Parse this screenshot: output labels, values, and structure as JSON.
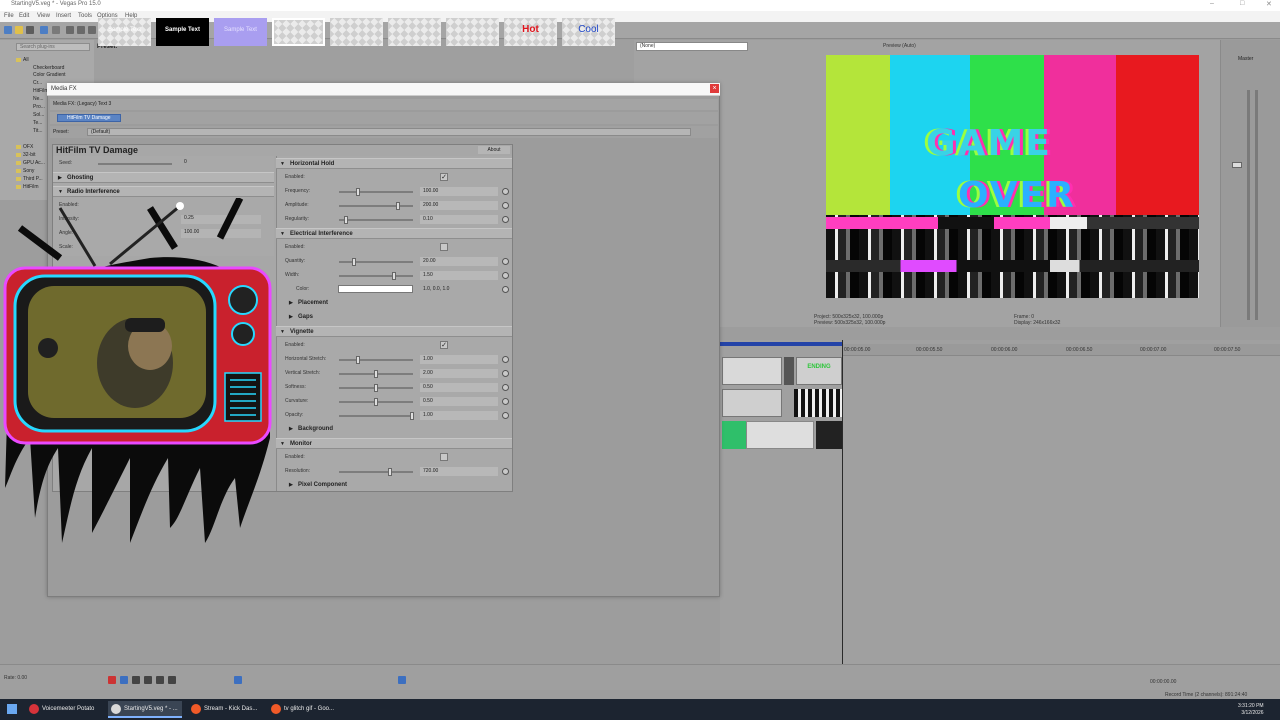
{
  "window": {
    "title": "StartingV5.veg * - Vegas Pro 15.0",
    "menu": [
      "File",
      "Edit",
      "View",
      "Insert",
      "Tools",
      "Options",
      "Help"
    ]
  },
  "explorer": {
    "search_placeholder": "Search plug-ins",
    "items": [
      "All",
      "Checkerboard",
      "Color Gradient",
      "Cr...",
      "HitFilm",
      "Ne...",
      "Pro...",
      "Sol...",
      "Te...",
      "Tit...",
      "OFX",
      "32-bit",
      "GPU Ac...",
      "Sony",
      "Third P...",
      "HitFilm"
    ]
  },
  "presets": {
    "label": "Preset:",
    "items": [
      {
        "text": "Sample Text",
        "style": "checker"
      },
      {
        "text": "Sample Text",
        "style": "black"
      },
      {
        "text": "Sample Text",
        "style": "purple"
      },
      {
        "text": "",
        "style": "checker"
      },
      {
        "text": "",
        "style": "checker"
      },
      {
        "text": "",
        "style": "checker"
      },
      {
        "text": "",
        "style": "checker"
      },
      {
        "text": "Hot",
        "style": "hot"
      },
      {
        "text": "Cool",
        "style": "cool"
      }
    ]
  },
  "preview": {
    "dropdown_value": "(None)",
    "quality_label": "Preview (Auto)",
    "title_line1": "GAME",
    "title_line2": "OVER",
    "project_line": "Project:  500x325x32, 100.000p",
    "preview_line": "Preview:  500x325x32, 100.000p",
    "frame_label": "Frame:",
    "frame_value": "0",
    "display_label": "Display:",
    "display_value": "246x166x32"
  },
  "mixer": {
    "label": "Master"
  },
  "timeline": {
    "ruler": [
      "00:00:05.00",
      "00:00:05.50",
      "00:00:06.00",
      "00:00:06.50",
      "00:00:07.00",
      "00:00:07.50"
    ],
    "clip_label": "ENDING"
  },
  "transport": {
    "rate": "Rate: 0.00",
    "time": "00:00:00.00",
    "record_time": "Record Time (2 channels): 891:24:40"
  },
  "mediafx": {
    "title": "Media FX",
    "header": "Media FX:  (Legacy) Text 3",
    "chain_item": "HitFilm TV Damage",
    "preset_label": "Preset:",
    "preset_value": "(Default)",
    "plugin_title": "HitFilm TV Damage",
    "about": "About",
    "left": {
      "seed_label": "Seed:",
      "seed_value": "0",
      "ghosting": "Ghosting",
      "radio_interference": "Radio Interference",
      "enabled_label": "Enabled:",
      "intensity_label": "Intensity:",
      "intensity_value": "0.25",
      "angle_label": "Angle:",
      "angle_value": "100.00",
      "scale_label": "Scale:"
    },
    "right": {
      "horizontal_hold": "Horizontal Hold",
      "hh_enabled": "Enabled:",
      "frequency_label": "Frequency:",
      "frequency_value": "100.00",
      "amplitude_label": "Amplitude:",
      "amplitude_value": "200.00",
      "regularity_label": "Regularity:",
      "regularity_value": "0.10",
      "electrical_interference": "Electrical Interference",
      "ei_enabled": "Enabled:",
      "quantity_label": "Quantity:",
      "quantity_value": "20.00",
      "width_label": "Width:",
      "width_value": "1.50",
      "color_label": "Color:",
      "color_value": "1.0, 0.0, 1.0",
      "placement": "Placement",
      "gaps": "Gaps",
      "vignette": "Vignette",
      "vg_enabled": "Enabled:",
      "hstretch_label": "Horizontal Stretch:",
      "hstretch_value": "1.00",
      "vstretch_label": "Vertical Stretch:",
      "vstretch_value": "2.00",
      "softness_label": "Softness:",
      "softness_value": "0.50",
      "curvature_label": "Curvature:",
      "curvature_value": "0.50",
      "opacity_label": "Opacity:",
      "opacity_value": "1.00",
      "background": "Background",
      "monitor": "Monitor",
      "mon_enabled": "Enabled:",
      "resolution_label": "Resolution:",
      "resolution_value": "720.00",
      "pixel_component": "Pixel Component"
    }
  },
  "taskbar": {
    "items": [
      {
        "label": "Voicemeeter Potato",
        "icon_color": "#d6333a"
      },
      {
        "label": "StartingV5.veg * - ...",
        "icon_color": "#d9d9d9",
        "active": true
      },
      {
        "label": "Stream - Kick Das...",
        "icon_color": "#f05a28"
      },
      {
        "label": "tv glitch gif - Goo...",
        "icon_color": "#f05a28"
      }
    ],
    "time": "3:31:20 PM",
    "date": "3/12/2026"
  },
  "colors": {
    "bars": [
      "#b4e53a",
      "#1dd4f0",
      "#2ee04a",
      "#f02f9c",
      "#e8191f"
    ]
  }
}
